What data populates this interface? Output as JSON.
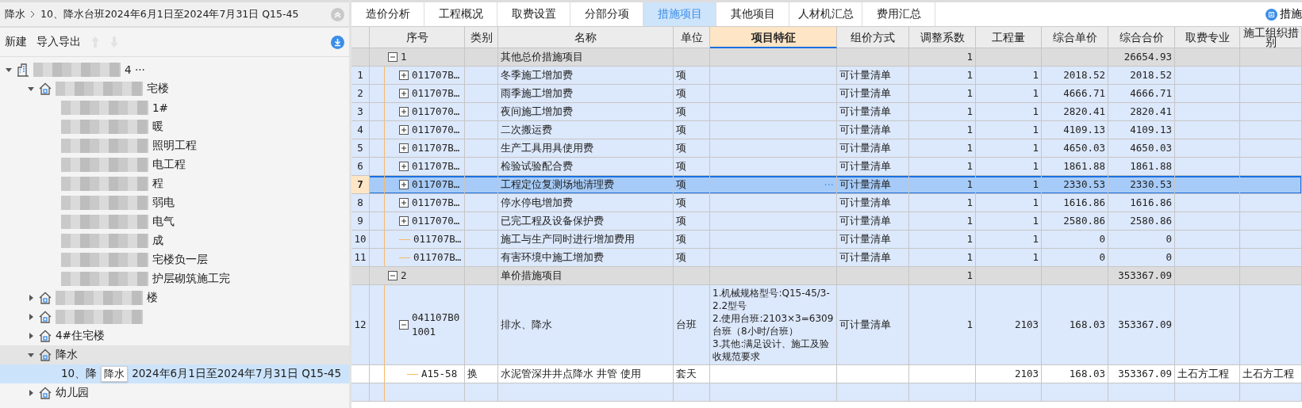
{
  "breadcrumb": {
    "items": [
      "降水",
      "10、降水台班2024年6月1日至2024年7月31日 Q15-45"
    ]
  },
  "toolbar": {
    "buttons": [
      {
        "label": "新建"
      },
      {
        "label": "导入导出"
      }
    ],
    "move_up_disabled": true,
    "move_down_disabled": true
  },
  "tree": [
    {
      "kind": "project",
      "expanded": true,
      "redacted": true,
      "selected": false,
      "label": "4 ···",
      "children": [
        {
          "kind": "building",
          "expanded": true,
          "redacted": true,
          "selected": false,
          "label": "宅楼",
          "children": [
            {
              "kind": "unit",
              "redacted": true,
              "selected": false,
              "label": "1#"
            },
            {
              "kind": "unit",
              "redacted": true,
              "selected": false,
              "label": "暖"
            },
            {
              "kind": "unit",
              "redacted": true,
              "selected": false,
              "label": "照明工程"
            },
            {
              "kind": "unit",
              "redacted": true,
              "selected": false,
              "label": "电工程"
            },
            {
              "kind": "unit",
              "redacted": true,
              "selected": false,
              "label": "程"
            },
            {
              "kind": "unit",
              "redacted": true,
              "selected": false,
              "label": "弱电"
            },
            {
              "kind": "unit",
              "redacted": true,
              "selected": false,
              "label": "电气"
            },
            {
              "kind": "unit",
              "redacted": true,
              "selected": false,
              "label": "成"
            },
            {
              "kind": "unit",
              "redacted": true,
              "selected": false,
              "label": "宅楼负一层"
            },
            {
              "kind": "unit",
              "redacted": true,
              "selected": false,
              "label": "护层砌筑施工完"
            }
          ]
        },
        {
          "kind": "building",
          "expanded": false,
          "redacted": true,
          "selected": false,
          "label": "楼"
        },
        {
          "kind": "building",
          "expanded": false,
          "redacted": true,
          "selected": false
        },
        {
          "kind": "building",
          "expanded": false,
          "redacted": false,
          "selected": false,
          "label": "4#住宅楼"
        },
        {
          "kind": "building",
          "expanded": true,
          "redacted": false,
          "selected": false,
          "label": "降水",
          "children": [
            {
              "kind": "unit",
              "redacted": false,
              "selected": true,
              "label": "10、降",
              "tooltip": "降水",
              "label_after": "2024年6月1日至2024年7月31日 Q15-45"
            }
          ]
        },
        {
          "kind": "building",
          "expanded": false,
          "redacted": false,
          "selected": false,
          "label": "幼儿园"
        }
      ]
    }
  ],
  "tabs": [
    {
      "label": "造价分析",
      "selected": false
    },
    {
      "label": "工程概况",
      "selected": false
    },
    {
      "label": "取费设置",
      "selected": false
    },
    {
      "label": "分部分项",
      "selected": false
    },
    {
      "label": "措施项目",
      "selected": true
    },
    {
      "label": "其他项目",
      "selected": false
    },
    {
      "label": "人材机汇总",
      "selected": false
    },
    {
      "label": "费用汇总",
      "selected": false
    }
  ],
  "template_button": {
    "label": "措施"
  },
  "table": {
    "columns": [
      {
        "selected": false
      },
      {
        "label": "序号",
        "selected": false
      },
      {
        "label": "类别",
        "selected": false
      },
      {
        "label": "名称",
        "selected": false
      },
      {
        "label": "单位",
        "selected": false
      },
      {
        "label": "项目特征",
        "selected": true
      },
      {
        "label": "组价方式",
        "selected": false
      },
      {
        "label": "调整系数",
        "selected": false
      },
      {
        "label": "工程量",
        "selected": false
      },
      {
        "label": "综合单价",
        "selected": false
      },
      {
        "label": "综合合价",
        "selected": false
      },
      {
        "label": "取费专业",
        "selected": false
      },
      {
        "label": "施工组织措别",
        "selected": false
      }
    ],
    "rows": [
      {
        "kind": "group",
        "selected": false,
        "expanded": true,
        "code": "1",
        "name": "其他总价措施项目",
        "coef": "1",
        "total": "26654.93"
      },
      {
        "kind": "item",
        "selected": false,
        "expanded": false,
        "num": "1",
        "code": "011707B…",
        "name": "冬季施工增加费",
        "unit": "项",
        "method": "可计量清单",
        "coef": "1",
        "qty": "1",
        "price": "2018.52",
        "total": "2018.52"
      },
      {
        "kind": "item",
        "selected": false,
        "expanded": false,
        "num": "2",
        "code": "011707B…",
        "name": "雨季施工增加费",
        "unit": "项",
        "method": "可计量清单",
        "coef": "1",
        "qty": "1",
        "price": "4666.71",
        "total": "4666.71"
      },
      {
        "kind": "item",
        "selected": false,
        "expanded": false,
        "num": "3",
        "code": "0117070…",
        "name": "夜间施工增加费",
        "unit": "项",
        "method": "可计量清单",
        "coef": "1",
        "qty": "1",
        "price": "2820.41",
        "total": "2820.41"
      },
      {
        "kind": "item",
        "selected": false,
        "expanded": false,
        "num": "4",
        "code": "0117070…",
        "name": "二次搬运费",
        "unit": "项",
        "method": "可计量清单",
        "coef": "1",
        "qty": "1",
        "price": "4109.13",
        "total": "4109.13"
      },
      {
        "kind": "item",
        "selected": false,
        "expanded": false,
        "num": "5",
        "code": "011707B…",
        "name": "生产工具用具使用费",
        "unit": "项",
        "method": "可计量清单",
        "coef": "1",
        "qty": "1",
        "price": "4650.03",
        "total": "4650.03"
      },
      {
        "kind": "item",
        "selected": false,
        "expanded": false,
        "num": "6",
        "code": "011707B…",
        "name": "检验试验配合费",
        "unit": "项",
        "method": "可计量清单",
        "coef": "1",
        "qty": "1",
        "price": "1861.88",
        "total": "1861.88"
      },
      {
        "kind": "item",
        "selected": true,
        "expanded": false,
        "num": "7",
        "code": "011707B…",
        "name": "工程定位复测场地清理费",
        "unit": "项",
        "edit_button": "···",
        "method": "可计量清单",
        "coef": "1",
        "qty": "1",
        "price": "2330.53",
        "total": "2330.53"
      },
      {
        "kind": "item",
        "selected": false,
        "expanded": false,
        "num": "8",
        "code": "011707B…",
        "name": "停水停电增加费",
        "unit": "项",
        "method": "可计量清单",
        "coef": "1",
        "qty": "1",
        "price": "1616.86",
        "total": "1616.86"
      },
      {
        "kind": "item",
        "selected": false,
        "expanded": false,
        "num": "9",
        "code": "0117070…",
        "name": "已完工程及设备保护费",
        "unit": "项",
        "method": "可计量清单",
        "coef": "1",
        "qty": "1",
        "price": "2580.86",
        "total": "2580.86"
      },
      {
        "kind": "item",
        "selected": false,
        "num": "10",
        "code": "011707B…",
        "name": "施工与生产同时进行增加费用",
        "unit": "项",
        "method": "可计量清单",
        "coef": "1",
        "qty": "1",
        "price": "0",
        "total": "0"
      },
      {
        "kind": "item",
        "selected": false,
        "num": "11",
        "code": "011707B…",
        "name": "有害环境中施工增加费",
        "unit": "项",
        "method": "可计量清单",
        "coef": "1",
        "qty": "1",
        "price": "0",
        "total": "0"
      },
      {
        "kind": "group",
        "selected": false,
        "expanded": true,
        "code": "2",
        "name": "单价措施项目",
        "coef": "1",
        "total": "353367.09"
      },
      {
        "kind": "item",
        "selected": false,
        "expanded": true,
        "num": "12",
        "code": "041107B01001",
        "name": "排水、降水",
        "unit": "台班",
        "feature": "1.机械规格型号:Q15-45/3-2.2型号\n2.使用台班:2103×3=6309台班（8小时/台班）\n3.其他:满足设计、施工及验收规范要求",
        "method": "可计量清单",
        "coef": "1",
        "qty": "2103",
        "price": "168.03",
        "total": "353367.09"
      },
      {
        "kind": "sub",
        "selected": false,
        "code": "A15-58",
        "type": "换",
        "name": "水泥管深井井点降水 井管 使用",
        "unit": "套天",
        "qty": "2103",
        "price": "168.03",
        "total": "353367.09",
        "fee": "土石方工程",
        "col_12": "土石方工程"
      },
      {
        "kind": "item",
        "selected": false
      }
    ]
  }
}
